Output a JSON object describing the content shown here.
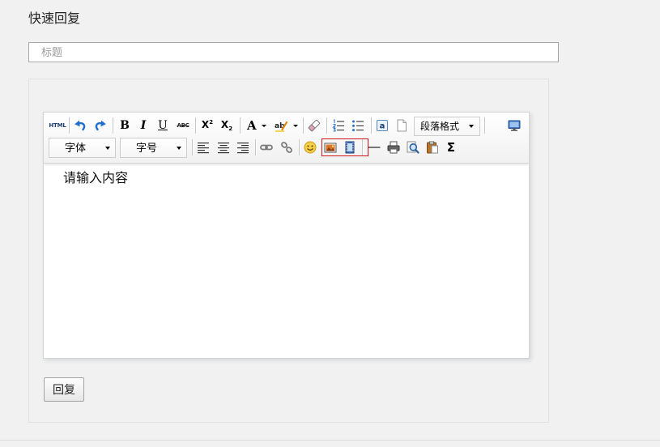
{
  "page": {
    "title": "快速回复"
  },
  "title_input": {
    "placeholder": "标题"
  },
  "editor": {
    "toolbar": {
      "source": {
        "icon": "html-source-icon",
        "label": "HTML"
      },
      "undo": {
        "icon": "undo-icon"
      },
      "redo": {
        "icon": "redo-icon"
      },
      "bold": {
        "icon": "bold-icon",
        "glyph": "B"
      },
      "italic": {
        "icon": "italic-icon",
        "glyph": "I"
      },
      "underline": {
        "icon": "underline-icon",
        "glyph": "U"
      },
      "strikethrough": {
        "icon": "strikethrough-icon",
        "glyph": "ABC"
      },
      "superscript": {
        "icon": "superscript-icon",
        "base": "X",
        "script": "2"
      },
      "subscript": {
        "icon": "subscript-icon",
        "base": "X",
        "script": "2"
      },
      "forecolor": {
        "icon": "font-color-icon",
        "glyph": "A"
      },
      "backcolor": {
        "icon": "highlight-color-icon",
        "glyph": "ab"
      },
      "removeformat": {
        "icon": "eraser-icon"
      },
      "ordered_list": {
        "icon": "ordered-list-icon"
      },
      "unordered_list": {
        "icon": "unordered-list-icon"
      },
      "pasteplain": {
        "icon": "paste-plain-icon",
        "glyph": "a"
      },
      "cleardoc": {
        "icon": "blank-page-icon"
      },
      "paragraph": {
        "value": "段落格式"
      },
      "fullscreen": {
        "icon": "monitor-icon"
      },
      "fontfamily": {
        "value": "字体"
      },
      "fontsize": {
        "value": "字号"
      },
      "justify_left": {
        "icon": "align-left-icon"
      },
      "justify_center": {
        "icon": "align-center-icon"
      },
      "justify_right": {
        "icon": "align-right-icon"
      },
      "link": {
        "icon": "link-icon"
      },
      "unlink": {
        "icon": "unlink-icon"
      },
      "emotion": {
        "icon": "emoji-icon"
      },
      "image": {
        "icon": "image-icon",
        "highlighted": true
      },
      "video": {
        "icon": "video-icon",
        "highlighted": true
      },
      "horizontal_rule": {
        "icon": "horizontal-line-icon"
      },
      "print": {
        "icon": "print-icon"
      },
      "preview": {
        "icon": "preview-icon"
      },
      "template": {
        "icon": "template-icon"
      },
      "formula": {
        "icon": "sigma-icon",
        "glyph": "Σ"
      }
    },
    "content": "请输入内容"
  },
  "reply_button": {
    "label": "回复"
  },
  "colors": {
    "page_background": "#f1f1f1",
    "highlight_border": "#d0141b",
    "icon_blue": "#1f6fd0"
  }
}
